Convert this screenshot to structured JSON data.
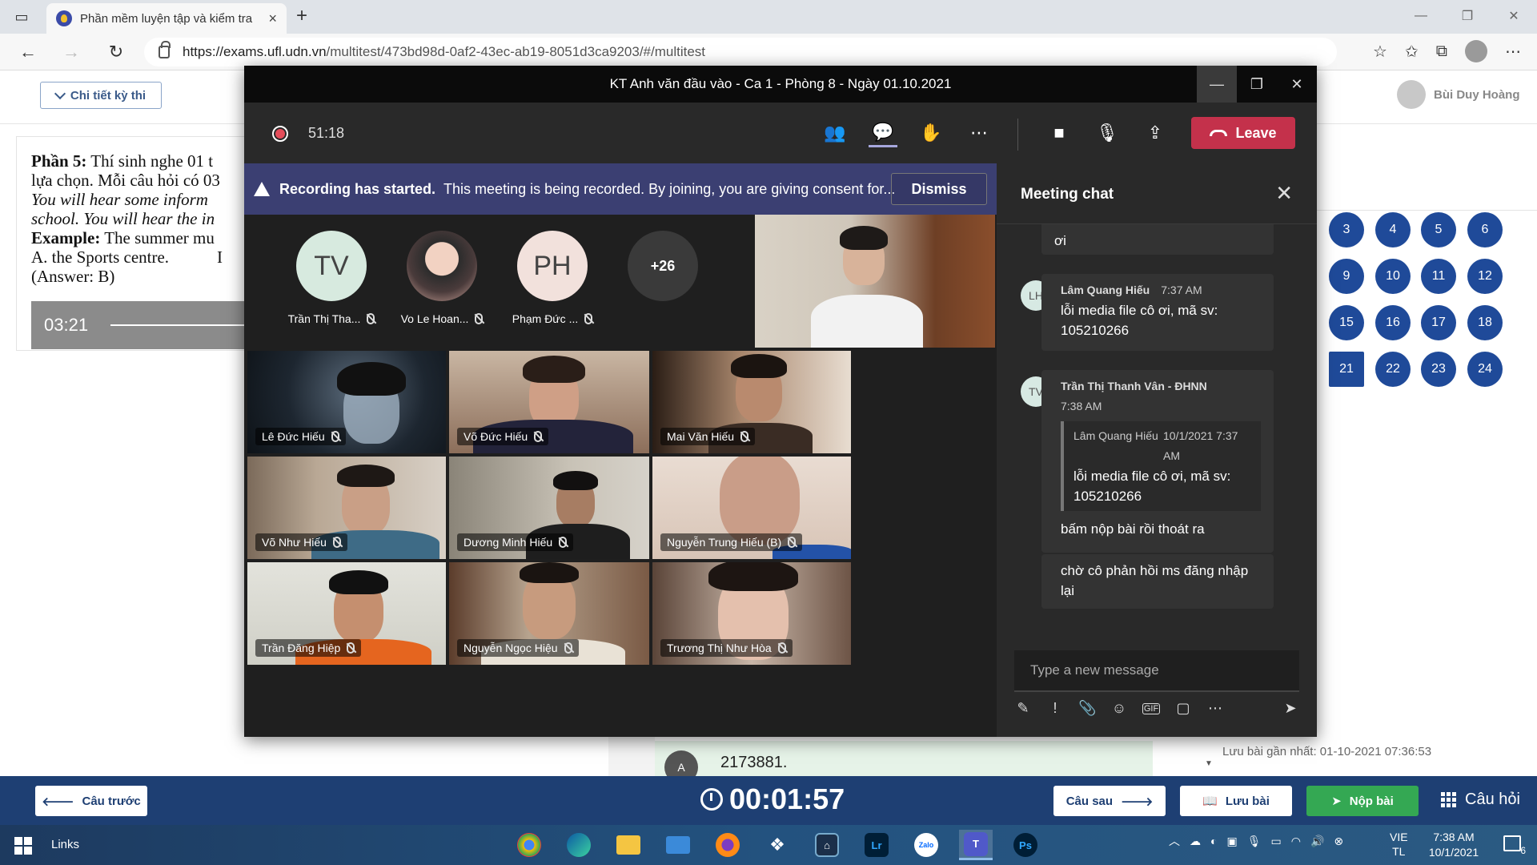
{
  "browser": {
    "tab_title": "Phần mềm luyện tập và kiểm tra",
    "url_host": "https://exams.ufl.udn.vn",
    "url_path": "/multitest/473bd98d-0af2-43ec-ab19-8051d3ca9203/#/multitest",
    "window_controls": [
      "—",
      "❐",
      "✕"
    ]
  },
  "exam": {
    "detail_button": "Chi tiết kỳ thi",
    "user_name": "Bùi Duy Hoàng",
    "question": {
      "part_label": "Phần 5:",
      "line1": " Thí sinh nghe 01 t",
      "line2": "lựa chọn. Mỗi câu hỏi có 03",
      "line3": "You will hear some inform",
      "line4": "school. You will hear the in",
      "example_label": "Example:",
      "example_text": " The summer mu",
      "option_a": "A. the Sports centre.",
      "option_b_fragment": "I",
      "answer": "(Answer: B)"
    },
    "audio_time": "03:21",
    "question_numbers": [
      "3",
      "4",
      "5",
      "6",
      "9",
      "10",
      "11",
      "12",
      "15",
      "16",
      "17",
      "18",
      "21",
      "22",
      "23",
      "24"
    ],
    "save_note": "Lưu bài gần nhất: 01-10-2021 07:36:53",
    "answer_avatar": "A",
    "answer_text": "2173881.",
    "prev_button": "Câu trước",
    "timer": "00:01:57",
    "next_button": "Câu sau",
    "save_button": "Lưu bài",
    "submit_button": "Nộp bài",
    "questions_menu": "Câu hỏi"
  },
  "teams": {
    "window_title": "KT Anh văn đầu vào - Ca 1 - Phòng 8 - Ngày 01.10.2021",
    "call_time": "51:18",
    "leave_label": "Leave",
    "banner_bold": "Recording has started.",
    "banner_text": "This meeting is being recorded. By joining, you are giving consent for...",
    "dismiss_label": "Dismiss",
    "avatars": [
      {
        "initials": "TV",
        "name": "Trần Thị Tha..."
      },
      {
        "initials": "",
        "name": "Vo Le Hoan..."
      },
      {
        "initials": "PH",
        "name": "Phạm Đức ..."
      }
    ],
    "more_count": "+26",
    "tiles": [
      {
        "name": "Lê Đức Hiếu"
      },
      {
        "name": "Võ Đức Hiếu"
      },
      {
        "name": "Mai Văn Hiếu"
      },
      {
        "name": "Võ Như Hiếu"
      },
      {
        "name": "Dương Minh Hiếu"
      },
      {
        "name": "Nguyễn Trung Hiếu (B)"
      },
      {
        "name": "Trần Đăng Hiệp"
      },
      {
        "name": "Nguyễn Ngọc Hiệu"
      },
      {
        "name": "Trương Thị Như Hòa"
      }
    ],
    "chat": {
      "title": "Meeting chat",
      "msg0_tail": "ơi",
      "msg1_author": "Lâm Quang Hiếu",
      "msg1_time": "7:37 AM",
      "msg1_initials": "LH",
      "msg1_text": "lỗi media file cô ơi, mã sv: 105210266",
      "msg2_author": "Trần Thị Thanh Vân - ĐHNN",
      "msg2_time": "7:38 AM",
      "msg2_initials": "TV",
      "quote_author": "Lâm Quang Hiếu",
      "quote_time": "10/1/2021 7:37 AM",
      "quote_text": "lỗi media file cô ơi, mã sv: 105210266",
      "msg2_text": "bấm nộp bài rồi thoát ra",
      "msg3_text": "chờ cô phản hồi ms đăng nhập lại",
      "compose_placeholder": "Type a new message"
    }
  },
  "taskbar": {
    "links": "Links",
    "lang1": "VIE",
    "lang2": "TL",
    "time": "7:38 AM",
    "date": "10/1/2021",
    "notif_count": "6"
  }
}
